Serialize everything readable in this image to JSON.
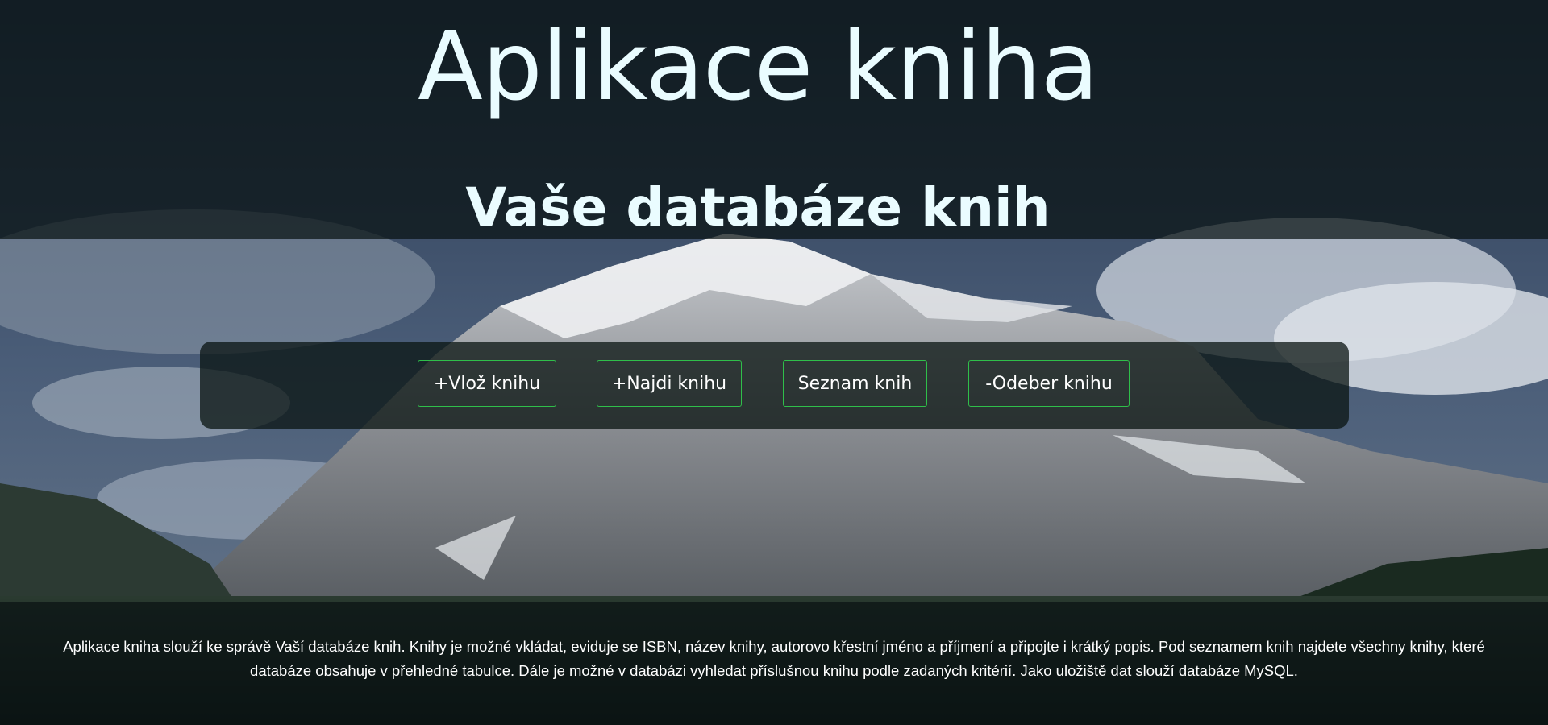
{
  "header": {
    "title": "Aplikace kniha",
    "subtitle": "Vaše databáze knih"
  },
  "nav": {
    "buttons": [
      {
        "label": "+Vlož knihu"
      },
      {
        "label": "+Najdi knihu"
      },
      {
        "label": "Seznam knih"
      },
      {
        "label": "-Odeber knihu"
      }
    ]
  },
  "footer": {
    "description": "Aplikace kniha slouží ke správě Vaší databáze knih. Knihy je možné vkládat, eviduje se ISBN, název knihy, autorovo křestní jméno a příjmení a připojte i krátký popis. Pod seznamem knih najdete všechny knihy, které databáze obsahuje v přehledné tabulce. Dále je možné v databázi vyhledat příslušnou knihu podle zadaných kritérií. Jako uložiště dat slouží databáze MySQL."
  },
  "colors": {
    "button_border": "#2fbf4a",
    "title_text": "#eafcff",
    "overlay": "#081212"
  }
}
